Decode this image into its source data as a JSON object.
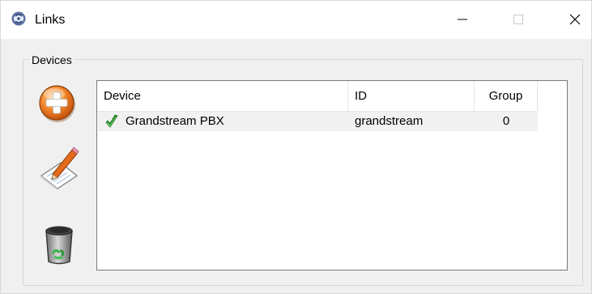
{
  "window": {
    "title": "Links",
    "controls": {
      "minimize": "minimize-icon",
      "maximize": "maximize-icon",
      "close": "close-icon"
    }
  },
  "groupbox": {
    "label": "Devices"
  },
  "actions": {
    "add_icon": "add-device-icon",
    "edit_icon": "edit-device-icon",
    "delete_icon": "recycle-bin-icon"
  },
  "table": {
    "columns": [
      "Device",
      "ID",
      "Group"
    ],
    "rows": [
      {
        "status_icon": "green-check-icon",
        "device": "Grandstream PBX",
        "id": "grandstream",
        "group": "0"
      }
    ]
  }
}
